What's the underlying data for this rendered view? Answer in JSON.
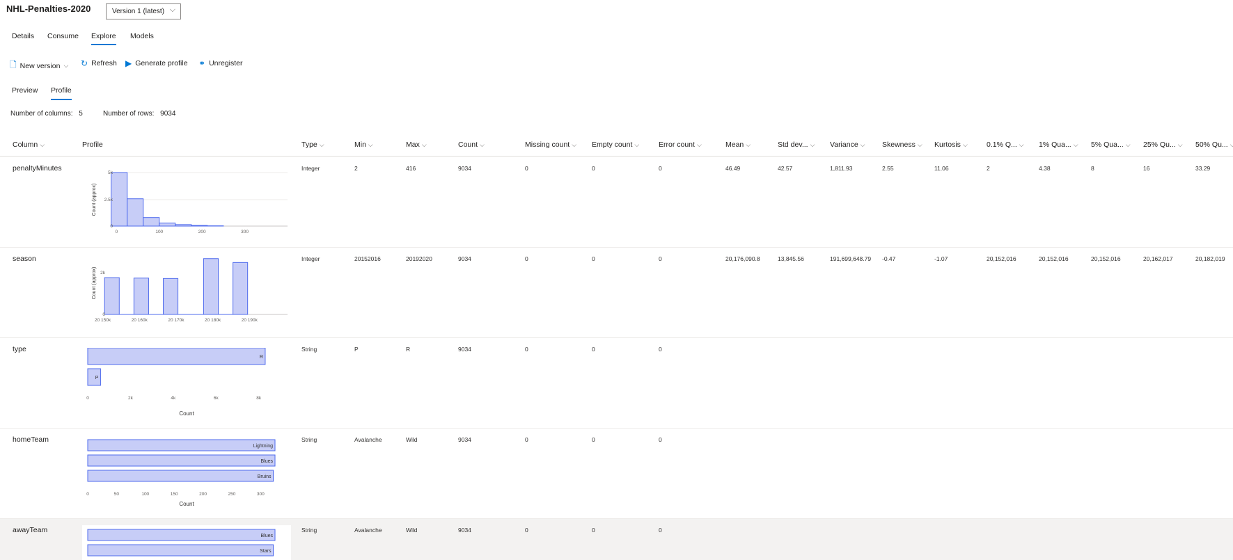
{
  "header": {
    "title": "NHL-Penalties-2020",
    "version_select": "Version 1 (latest)"
  },
  "tabs": [
    {
      "label": "Details"
    },
    {
      "label": "Consume"
    },
    {
      "label": "Explore",
      "active": true
    },
    {
      "label": "Models"
    }
  ],
  "toolbar": {
    "new_version": "New version",
    "refresh": "Refresh",
    "generate_profile": "Generate profile",
    "unregister": "Unregister"
  },
  "subtabs": [
    {
      "label": "Preview"
    },
    {
      "label": "Profile",
      "active": true
    }
  ],
  "summary": {
    "columns_label": "Number of columns:",
    "columns_value": "5",
    "rows_label": "Number of rows:",
    "rows_value": "9034"
  },
  "columns": [
    "Column",
    "Profile",
    "Type",
    "Min",
    "Max",
    "Count",
    "Missing count",
    "Empty count",
    "Error count",
    "Mean",
    "Std dev...",
    "Variance",
    "Skewness",
    "Kurtosis",
    "0.1% Q...",
    "1% Qua...",
    "5% Qua...",
    "25% Qu...",
    "50% Qu..."
  ],
  "rows": [
    {
      "name": "penaltyMinutes",
      "type": "Integer",
      "min": "2",
      "max": "416",
      "count": "9034",
      "missing": "0",
      "empty": "0",
      "error": "0",
      "mean": "46.49",
      "std": "42.57",
      "variance": "1,811.93",
      "skewness": "2.55",
      "kurtosis": "11.06",
      "q01": "2",
      "q1": "4.38",
      "q5": "8",
      "q25": "16",
      "q50": "33.29"
    },
    {
      "name": "season",
      "type": "Integer",
      "min": "20152016",
      "max": "20192020",
      "count": "9034",
      "missing": "0",
      "empty": "0",
      "error": "0",
      "mean": "20,176,090.8",
      "std": "13,845.56",
      "variance": "191,699,648.79",
      "skewness": "-0.47",
      "kurtosis": "-1.07",
      "q01": "20,152,016",
      "q1": "20,152,016",
      "q5": "20,152,016",
      "q25": "20,162,017",
      "q50": "20,182,019"
    },
    {
      "name": "type",
      "type": "String",
      "min": "P",
      "max": "R",
      "count": "9034",
      "missing": "0",
      "empty": "0",
      "error": "0",
      "mean": "",
      "std": "",
      "variance": "",
      "skewness": "",
      "kurtosis": "",
      "q01": "",
      "q1": "",
      "q5": "",
      "q25": "",
      "q50": ""
    },
    {
      "name": "homeTeam",
      "type": "String",
      "min": "Avalanche",
      "max": "Wild",
      "count": "9034",
      "missing": "0",
      "empty": "0",
      "error": "0",
      "mean": "",
      "std": "",
      "variance": "",
      "skewness": "",
      "kurtosis": "",
      "q01": "",
      "q1": "",
      "q5": "",
      "q25": "",
      "q50": ""
    },
    {
      "name": "awayTeam",
      "type": "String",
      "min": "Avalanche",
      "max": "Wild",
      "count": "9034",
      "missing": "0",
      "empty": "0",
      "error": "0",
      "mean": "",
      "std": "",
      "variance": "",
      "skewness": "",
      "kurtosis": "",
      "q01": "",
      "q1": "",
      "q5": "",
      "q25": "",
      "q50": ""
    }
  ],
  "colors": {
    "accent": "#0078d4",
    "bar_fill": "#c7cdf7",
    "bar_stroke": "#4f6bed"
  },
  "chart_data": [
    {
      "type": "bar",
      "ylabel": "Count (approx)",
      "x_ticks": [
        "0",
        "100",
        "200",
        "300"
      ],
      "y_ticks": [
        "0",
        "2.5k",
        "5k"
      ],
      "x_range": [
        -25,
        400
      ],
      "ylim": [
        0,
        5000
      ],
      "bins": [
        [
          -12.5,
          25,
          5000
        ],
        [
          25,
          62.5,
          2550
        ],
        [
          62.5,
          100,
          800
        ],
        [
          100,
          137.5,
          280
        ],
        [
          137.5,
          175,
          140
        ],
        [
          175,
          212.5,
          60
        ],
        [
          212.5,
          250,
          25
        ]
      ]
    },
    {
      "type": "bar",
      "ylabel": "Count (approx)",
      "x_ticks": [
        "20 150k",
        "20 160k",
        "20 170k",
        "20 180k",
        "20 190k"
      ],
      "y_ticks": [
        "0",
        "2k"
      ],
      "x_tick_values": [
        20150000,
        20160000,
        20170000,
        20180000,
        20190000
      ],
      "x_range": [
        20149700,
        20190700
      ],
      "ylim": [
        0,
        2700
      ],
      "bins": [
        [
          20150500,
          20154500,
          1700
        ],
        [
          20154500,
          20158500,
          0
        ],
        [
          20158500,
          20162500,
          1680
        ],
        [
          20162500,
          20166500,
          0
        ],
        [
          20166500,
          20170500,
          1660
        ],
        [
          20170500,
          20177500,
          0
        ],
        [
          20177500,
          20181500,
          2580
        ],
        [
          20181500,
          20185500,
          0
        ],
        [
          20185500,
          20189500,
          2400
        ]
      ]
    },
    {
      "type": "bar",
      "orientation": "horizontal",
      "xlabel": "Count",
      "x_ticks": [
        "0",
        "2k",
        "4k",
        "6k",
        "8k"
      ],
      "x_tick_values": [
        0,
        2000,
        4000,
        6000,
        8000
      ],
      "xlim": [
        0,
        8400
      ],
      "categories": [
        "R",
        "P"
      ],
      "values": [
        8300,
        600
      ]
    },
    {
      "type": "bar",
      "orientation": "horizontal",
      "xlabel": "Count",
      "x_ticks": [
        "0",
        "50",
        "100",
        "150",
        "200",
        "250",
        "300"
      ],
      "x_tick_values": [
        0,
        50,
        100,
        150,
        200,
        250,
        300
      ],
      "xlim": [
        0,
        325
      ],
      "categories": [
        "Lightning",
        "Blues",
        "Bruins"
      ],
      "values": [
        325,
        325,
        322
      ]
    },
    {
      "type": "bar",
      "orientation": "horizontal",
      "categories": [
        "Blues",
        "Stars"
      ],
      "values": [
        325,
        322
      ],
      "xlim": [
        0,
        325
      ]
    }
  ]
}
